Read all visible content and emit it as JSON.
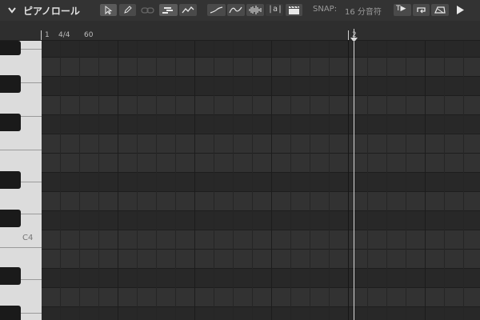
{
  "toolbar": {
    "title": "ピアノロール",
    "snap_label": "SNAP:",
    "snap_value": "16 分音符",
    "icons": [
      "chevron-down-icon",
      "pointer-tool-icon",
      "pencil-tool-icon",
      "link-icon",
      "step-input-icon",
      "curve-icon",
      "line-curve-icon",
      "wave-curve-icon",
      "audio-wave-icon",
      "lyrics-icon",
      "clapper-icon",
      "text-play-icon",
      "loop-icon",
      "sustain-icon",
      "play-icon"
    ],
    "lyrics_glyph": "|a|",
    "text_play_glyph": "T▶"
  },
  "ruler": {
    "bar1": "1",
    "time_signature": "4/4",
    "tempo": "60",
    "bar2": "2"
  },
  "keyboard": {
    "octave_label": "C4"
  },
  "colors": {
    "lane_light": "#323232",
    "lane_dark": "#282828",
    "white_key": "#dcdcdc",
    "black_key": "#1a1a1a",
    "playhead": "#d8d8d8"
  }
}
